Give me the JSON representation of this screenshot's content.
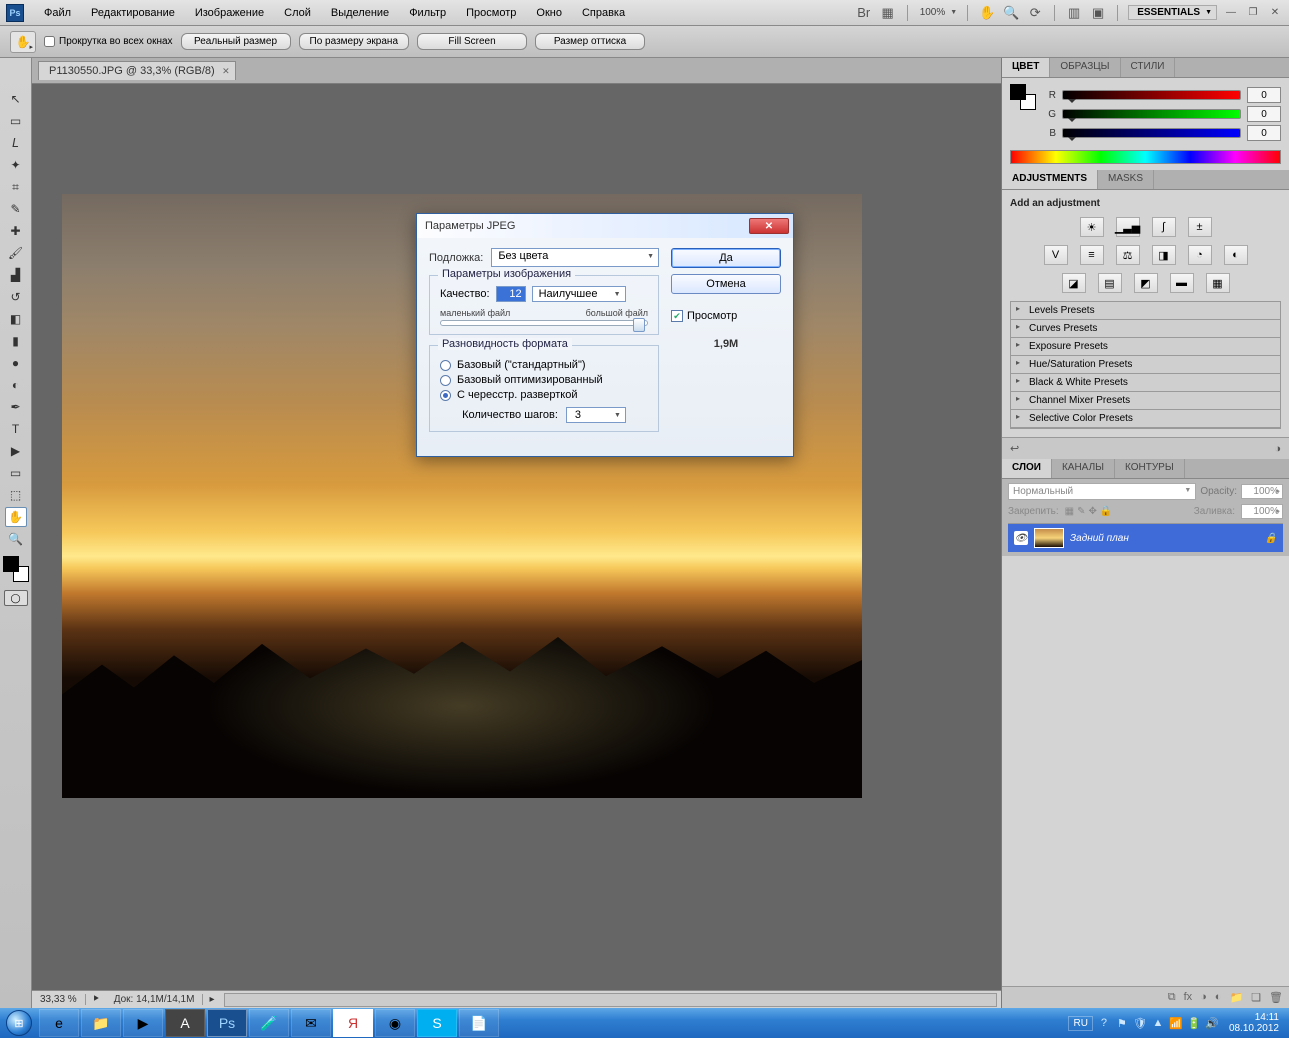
{
  "menubar": {
    "items": [
      "Файл",
      "Редактирование",
      "Изображение",
      "Слой",
      "Выделение",
      "Фильтр",
      "Просмотр",
      "Окно",
      "Справка"
    ],
    "zoom": "100%",
    "workspace": "ESSENTIALS"
  },
  "optionbar": {
    "scroll_all": "Прокрутка во всех окнах",
    "btn_actual": "Реальный размер",
    "btn_fit": "По размеру экрана",
    "btn_fill": "Fill Screen",
    "btn_print": "Размер оттиска"
  },
  "document": {
    "tab_title": "P1130550.JPG @ 33,3% (RGB/8)",
    "zoom_status": "33,33 %",
    "doc_info": "Док: 14,1M/14,1M"
  },
  "color_panel": {
    "tabs": [
      "ЦВЕТ",
      "ОБРАЗЦЫ",
      "СТИЛИ"
    ],
    "r": "0",
    "g": "0",
    "b": "0"
  },
  "adjustments_panel": {
    "tabs": [
      "ADJUSTMENTS",
      "MASKS"
    ],
    "heading": "Add an adjustment",
    "presets": [
      "Levels Presets",
      "Curves Presets",
      "Exposure Presets",
      "Hue/Saturation Presets",
      "Black & White Presets",
      "Channel Mixer Presets",
      "Selective Color Presets"
    ]
  },
  "layers_panel": {
    "tabs": [
      "СЛОИ",
      "КАНАЛЫ",
      "КОНТУРЫ"
    ],
    "blend_mode": "Нормальный",
    "opacity_label": "Opacity:",
    "opacity_value": "100%",
    "lock_label": "Закрепить:",
    "fill_label": "Заливка:",
    "fill_value": "100%",
    "background_layer": "Задний план"
  },
  "jpeg_dialog": {
    "title": "Параметры JPEG",
    "matte_label": "Подложка:",
    "matte_value": "Без цвета",
    "image_options_legend": "Параметры изображения",
    "quality_label": "Качество:",
    "quality_value": "12",
    "quality_preset": "Наилучшее",
    "small_file": "маленький файл",
    "big_file": "большой файл",
    "format_legend": "Разновидность формата",
    "format_opt1": "Базовый (\"стандартный\")",
    "format_opt2": "Базовый оптимизированный",
    "format_opt3": "С чересстр. разверткой",
    "steps_label": "Количество шагов:",
    "steps_value": "3",
    "btn_ok": "Да",
    "btn_cancel": "Отмена",
    "preview": "Просмотр",
    "filesize": "1,9M"
  },
  "taskbar": {
    "lang": "RU",
    "time": "14:11",
    "date": "08.10.2012"
  }
}
